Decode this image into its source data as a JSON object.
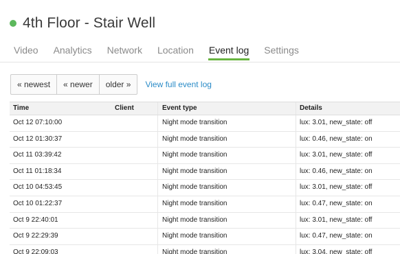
{
  "device": {
    "name": "4th Floor - Stair Well",
    "status_color": "#5cb85c"
  },
  "tabs": [
    {
      "label": "Video",
      "active": false
    },
    {
      "label": "Analytics",
      "active": false
    },
    {
      "label": "Network",
      "active": false
    },
    {
      "label": "Location",
      "active": false
    },
    {
      "label": "Event log",
      "active": true
    },
    {
      "label": "Settings",
      "active": false
    }
  ],
  "pager": {
    "newest": "« newest",
    "newer": "« newer",
    "older": "older »",
    "full_log_link": "View full event log"
  },
  "table": {
    "columns": [
      "Time",
      "Client",
      "Event type",
      "Details"
    ],
    "rows": [
      {
        "time": "Oct 12 07:10:00",
        "client": "",
        "event": "Night mode transition",
        "details": "lux: 3.01, new_state: off"
      },
      {
        "time": "Oct 12 01:30:37",
        "client": "",
        "event": "Night mode transition",
        "details": "lux: 0.46, new_state: on"
      },
      {
        "time": "Oct 11 03:39:42",
        "client": "",
        "event": "Night mode transition",
        "details": "lux: 3.01, new_state: off"
      },
      {
        "time": "Oct 11 01:18:34",
        "client": "",
        "event": "Night mode transition",
        "details": "lux: 0.46, new_state: on"
      },
      {
        "time": "Oct 10 04:53:45",
        "client": "",
        "event": "Night mode transition",
        "details": "lux: 3.01, new_state: off"
      },
      {
        "time": "Oct 10 01:22:37",
        "client": "",
        "event": "Night mode transition",
        "details": "lux: 0.47, new_state: on"
      },
      {
        "time": "Oct 9 22:40:01",
        "client": "",
        "event": "Night mode transition",
        "details": "lux: 3.01, new_state: off"
      },
      {
        "time": "Oct 9 22:29:39",
        "client": "",
        "event": "Night mode transition",
        "details": "lux: 0.47, new_state: on"
      },
      {
        "time": "Oct 9 22:09:03",
        "client": "",
        "event": "Night mode transition",
        "details": "lux: 3.04, new_state: off"
      }
    ]
  }
}
